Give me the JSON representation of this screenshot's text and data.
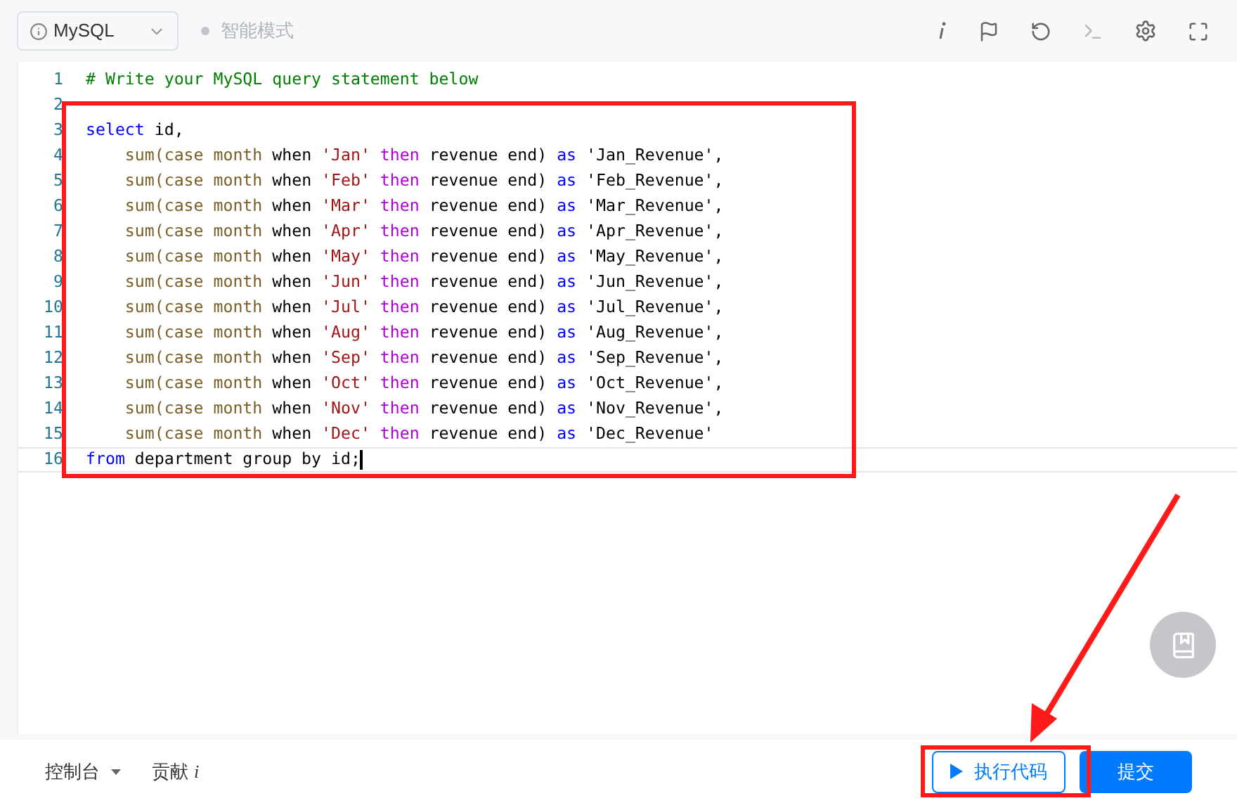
{
  "toolbar": {
    "language": "MySQL",
    "smart_mode": {
      "label": "智能模式",
      "on": false
    }
  },
  "editor": {
    "lines": [
      {
        "number": "1",
        "active": false,
        "tokens": [
          {
            "kind": "comment",
            "text": "# Write your MySQL query statement below"
          }
        ]
      },
      {
        "number": "2",
        "active": false
      },
      {
        "number": "3",
        "active": false,
        "tokens": [
          {
            "kind": "keyword",
            "text": "select"
          },
          {
            "kind": "plain",
            "text": " id,"
          }
        ]
      },
      {
        "number": "4",
        "active": false,
        "tokens": [
          {
            "kind": "function",
            "text": "    sum(case month "
          },
          {
            "kind": "plain",
            "text": "when "
          },
          {
            "kind": "string",
            "text": "'Jan'"
          },
          {
            "kind": "control",
            "text": " then"
          },
          {
            "kind": "plain",
            "text": " revenue end) "
          },
          {
            "kind": "keyword",
            "text": "as"
          },
          {
            "kind": "plain",
            "text": " 'Jan_Revenue',"
          }
        ]
      },
      {
        "number": "5",
        "active": false,
        "tokens": [
          {
            "kind": "function",
            "text": "    sum(case month "
          },
          {
            "kind": "plain",
            "text": "when "
          },
          {
            "kind": "string",
            "text": "'Feb'"
          },
          {
            "kind": "control",
            "text": " then"
          },
          {
            "kind": "plain",
            "text": " revenue end) "
          },
          {
            "kind": "keyword",
            "text": "as"
          },
          {
            "kind": "plain",
            "text": " 'Feb_Revenue',"
          }
        ]
      },
      {
        "number": "6",
        "active": false,
        "tokens": [
          {
            "kind": "function",
            "text": "    sum(case month "
          },
          {
            "kind": "plain",
            "text": "when "
          },
          {
            "kind": "string",
            "text": "'Mar'"
          },
          {
            "kind": "control",
            "text": " then"
          },
          {
            "kind": "plain",
            "text": " revenue end) "
          },
          {
            "kind": "keyword",
            "text": "as"
          },
          {
            "kind": "plain",
            "text": " 'Mar_Revenue',"
          }
        ]
      },
      {
        "number": "7",
        "active": false,
        "tokens": [
          {
            "kind": "function",
            "text": "    sum(case month "
          },
          {
            "kind": "plain",
            "text": "when "
          },
          {
            "kind": "string",
            "text": "'Apr'"
          },
          {
            "kind": "control",
            "text": " then"
          },
          {
            "kind": "plain",
            "text": " revenue end) "
          },
          {
            "kind": "keyword",
            "text": "as"
          },
          {
            "kind": "plain",
            "text": " 'Apr_Revenue',"
          }
        ]
      },
      {
        "number": "8",
        "active": false,
        "tokens": [
          {
            "kind": "function",
            "text": "    sum(case month "
          },
          {
            "kind": "plain",
            "text": "when "
          },
          {
            "kind": "string",
            "text": "'May'"
          },
          {
            "kind": "control",
            "text": " then"
          },
          {
            "kind": "plain",
            "text": " revenue end) "
          },
          {
            "kind": "keyword",
            "text": "as"
          },
          {
            "kind": "plain",
            "text": " 'May_Revenue',"
          }
        ]
      },
      {
        "number": "9",
        "active": false,
        "tokens": [
          {
            "kind": "function",
            "text": "    sum(case month "
          },
          {
            "kind": "plain",
            "text": "when "
          },
          {
            "kind": "string",
            "text": "'Jun'"
          },
          {
            "kind": "control",
            "text": " then"
          },
          {
            "kind": "plain",
            "text": " revenue end) "
          },
          {
            "kind": "keyword",
            "text": "as"
          },
          {
            "kind": "plain",
            "text": " 'Jun_Revenue',"
          }
        ]
      },
      {
        "number": "10",
        "active": false,
        "tokens": [
          {
            "kind": "function",
            "text": "    sum(case month "
          },
          {
            "kind": "plain",
            "text": "when "
          },
          {
            "kind": "string",
            "text": "'Jul'"
          },
          {
            "kind": "control",
            "text": " then"
          },
          {
            "kind": "plain",
            "text": " revenue end) "
          },
          {
            "kind": "keyword",
            "text": "as"
          },
          {
            "kind": "plain",
            "text": " 'Jul_Revenue',"
          }
        ]
      },
      {
        "number": "11",
        "active": false,
        "tokens": [
          {
            "kind": "function",
            "text": "    sum(case month "
          },
          {
            "kind": "plain",
            "text": "when "
          },
          {
            "kind": "string",
            "text": "'Aug'"
          },
          {
            "kind": "control",
            "text": " then"
          },
          {
            "kind": "plain",
            "text": " revenue end) "
          },
          {
            "kind": "keyword",
            "text": "as"
          },
          {
            "kind": "plain",
            "text": " 'Aug_Revenue',"
          }
        ]
      },
      {
        "number": "12",
        "active": false,
        "tokens": [
          {
            "kind": "function",
            "text": "    sum(case month "
          },
          {
            "kind": "plain",
            "text": "when "
          },
          {
            "kind": "string",
            "text": "'Sep'"
          },
          {
            "kind": "control",
            "text": " then"
          },
          {
            "kind": "plain",
            "text": " revenue end) "
          },
          {
            "kind": "keyword",
            "text": "as"
          },
          {
            "kind": "plain",
            "text": " 'Sep_Revenue',"
          }
        ]
      },
      {
        "number": "13",
        "active": false,
        "tokens": [
          {
            "kind": "function",
            "text": "    sum(case month "
          },
          {
            "kind": "plain",
            "text": "when "
          },
          {
            "kind": "string",
            "text": "'Oct'"
          },
          {
            "kind": "control",
            "text": " then"
          },
          {
            "kind": "plain",
            "text": " revenue end) "
          },
          {
            "kind": "keyword",
            "text": "as"
          },
          {
            "kind": "plain",
            "text": " 'Oct_Revenue',"
          }
        ]
      },
      {
        "number": "14",
        "active": false,
        "tokens": [
          {
            "kind": "function",
            "text": "    sum(case month "
          },
          {
            "kind": "plain",
            "text": "when "
          },
          {
            "kind": "string",
            "text": "'Nov'"
          },
          {
            "kind": "control",
            "text": " then"
          },
          {
            "kind": "plain",
            "text": " revenue end) "
          },
          {
            "kind": "keyword",
            "text": "as"
          },
          {
            "kind": "plain",
            "text": " 'Nov_Revenue',"
          }
        ]
      },
      {
        "number": "15",
        "active": false,
        "tokens": [
          {
            "kind": "function",
            "text": "    sum(case month "
          },
          {
            "kind": "plain",
            "text": "when "
          },
          {
            "kind": "string",
            "text": "'Dec'"
          },
          {
            "kind": "control",
            "text": " then"
          },
          {
            "kind": "plain",
            "text": " revenue end) "
          },
          {
            "kind": "keyword",
            "text": "as"
          },
          {
            "kind": "plain",
            "text": " 'Dec_Revenue'"
          }
        ]
      },
      {
        "number": "16",
        "active": true,
        "tokens": [
          {
            "kind": "keyword",
            "text": "from"
          },
          {
            "kind": "plain",
            "text": " department group by id;"
          }
        ]
      }
    ]
  },
  "bottom_bar": {
    "console": "控制台",
    "contribute": "贡献",
    "contribute_mark": "i",
    "run_button": "执行代码",
    "submit_button": "提交"
  }
}
